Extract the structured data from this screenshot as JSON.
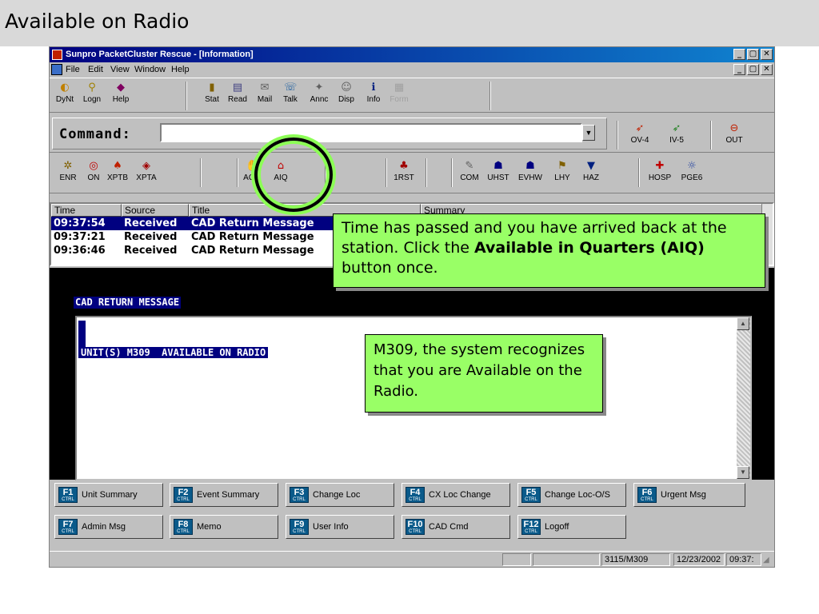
{
  "slide": {
    "title": "Available on Radio"
  },
  "window": {
    "title": "Sunpro PacketCluster Rescue - [Information]",
    "controls": [
      "_",
      "▢",
      "✕"
    ]
  },
  "menu": [
    {
      "label": "File"
    },
    {
      "label": "Edit"
    },
    {
      "label": "View"
    },
    {
      "label": "Window"
    },
    {
      "label": "Help"
    }
  ],
  "toolbar1": [
    {
      "label": "DyNt",
      "icon": "dynt-icon",
      "glyph": "◐",
      "color": "#c08000"
    },
    {
      "label": "Logn",
      "icon": "logon-icon",
      "glyph": "⚲",
      "color": "#a08000"
    },
    {
      "label": "Help",
      "icon": "help-book-icon",
      "glyph": "◆",
      "color": "#800060"
    },
    {
      "label": "Stat",
      "icon": "stat-icon",
      "glyph": "▮",
      "color": "#806000"
    },
    {
      "label": "Read",
      "icon": "read-icon",
      "glyph": "▤",
      "color": "#404080"
    },
    {
      "label": "Mail",
      "icon": "mail-icon",
      "glyph": "✉",
      "color": "#606060"
    },
    {
      "label": "Talk",
      "icon": "talk-icon",
      "glyph": "☏",
      "color": "#2060a0"
    },
    {
      "label": "Annc",
      "icon": "announce-icon",
      "glyph": "✦",
      "color": "#606060"
    },
    {
      "label": "Disp",
      "icon": "dispatch-icon",
      "glyph": "☺",
      "color": "#606060"
    },
    {
      "label": "Info",
      "icon": "info-icon",
      "glyph": "ℹ",
      "color": "#002080"
    },
    {
      "label": "Form",
      "icon": "form-icon",
      "glyph": "▦",
      "color": "#a0a0a0",
      "disabled": true
    }
  ],
  "command": {
    "label": "Command:",
    "value": "",
    "right_buttons": [
      {
        "label": "OV-4",
        "icon": "ov-arrow-icon",
        "glyph": "➶",
        "color": "#c02000"
      },
      {
        "label": "IV-5",
        "icon": "iv-arrow-icon",
        "glyph": "➶",
        "color": "#208020"
      },
      {
        "label": "OUT",
        "icon": "out-icon",
        "glyph": "⊖",
        "color": "#c02000"
      }
    ]
  },
  "toolbar2": [
    {
      "label": "ENR",
      "icon": "enroute-icon",
      "glyph": "✲",
      "color": "#806000"
    },
    {
      "label": "ON",
      "icon": "on-scene-icon",
      "glyph": "◎",
      "color": "#c00000"
    },
    {
      "label": "XPTB",
      "icon": "transport-b-icon",
      "glyph": "♠",
      "color": "#c02000"
    },
    {
      "label": "XPTA",
      "icon": "transport-a-icon",
      "glyph": "◈",
      "color": "#a00000"
    },
    {
      "label": "AOR",
      "icon": "aor-icon",
      "glyph": "✋",
      "color": "#806000"
    },
    {
      "label": "AIQ",
      "icon": "aiq-quarters-icon",
      "glyph": "⌂",
      "color": "#c00000"
    },
    {
      "label": "1RST",
      "icon": "first-responder-icon",
      "glyph": "♣",
      "color": "#a00000"
    },
    {
      "label": "COM",
      "icon": "com-icon",
      "glyph": "✎",
      "color": "#606060"
    },
    {
      "label": "UHST",
      "icon": "uhst-icon",
      "glyph": "☗",
      "color": "#000080"
    },
    {
      "label": "EVHW",
      "icon": "evhw-icon",
      "glyph": "☗",
      "color": "#000080"
    },
    {
      "label": "LHY",
      "icon": "lhy-icon",
      "glyph": "⚑",
      "color": "#806000"
    },
    {
      "label": "HAZ",
      "icon": "hazard-icon",
      "glyph": "▼",
      "color": "#002080"
    },
    {
      "label": "HOSP",
      "icon": "hospital-icon",
      "glyph": "✚",
      "color": "#c00000"
    },
    {
      "label": "PGE6",
      "icon": "pager-icon",
      "glyph": "☼",
      "color": "#2040a0"
    }
  ],
  "list": {
    "columns": [
      "Time",
      "Source",
      "Title",
      "Summary"
    ],
    "rows": [
      {
        "time": "09:37:54",
        "source": "Received",
        "title": "CAD Return Message",
        "selected": true
      },
      {
        "time": "09:37:21",
        "source": "Received",
        "title": "CAD Return Message",
        "selected": false
      },
      {
        "time": "09:36:46",
        "source": "Received",
        "title": "CAD Return Message",
        "selected": false
      }
    ]
  },
  "detail": {
    "header": "CAD RETURN MESSAGE",
    "line": "UNIT(S) M309  AVAILABLE ON RADIO"
  },
  "fkeys": [
    {
      "key": "F1",
      "label": "Unit Summary"
    },
    {
      "key": "F2",
      "label": "Event Summary"
    },
    {
      "key": "F3",
      "label": "Change Loc"
    },
    {
      "key": "F4",
      "label": "CX Loc Change"
    },
    {
      "key": "F5",
      "label": "Change Loc-O/S"
    },
    {
      "key": "F6",
      "label": "Urgent Msg"
    },
    {
      "key": "F7",
      "label": "Admin Msg"
    },
    {
      "key": "F8",
      "label": "Memo"
    },
    {
      "key": "F9",
      "label": "User Info"
    },
    {
      "key": "F10",
      "label": "CAD Cmd"
    },
    {
      "key": "F12",
      "label": "Logoff"
    }
  ],
  "fkey_modifier": "CTRL",
  "status": {
    "cell1": "",
    "cell2": "",
    "user": "3115/M309",
    "date": "12/23/2002",
    "time": "09:37:"
  },
  "callouts": {
    "aiq": {
      "before": "Time has passed and you have arrived back at the station. Click the ",
      "bold": "Available in Quarters (AIQ)",
      "after": " button once."
    },
    "radio": "M309, the system recognizes that you are Available on the Radio."
  },
  "colors": {
    "callout_bg": "#99ff66",
    "highlight_ring": "#000000",
    "selection": "#000080",
    "titlebar": "#000080"
  }
}
